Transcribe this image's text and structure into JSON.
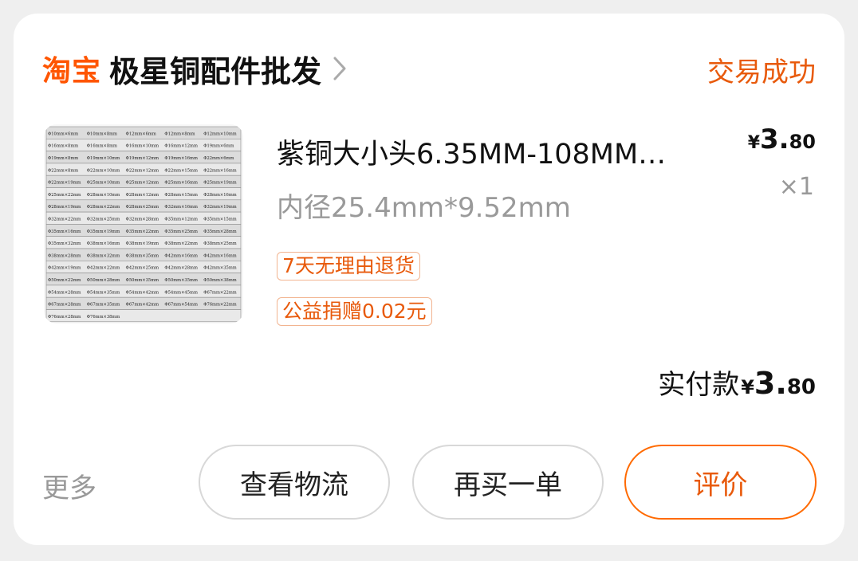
{
  "header": {
    "brand": "淘宝",
    "shop_name": "极星铜配件批发",
    "chevron_icon": "chevron-right-icon",
    "status": "交易成功"
  },
  "item": {
    "title": "紫铜大小头6.35MM-108MM…",
    "spec": "内径25.4mm*9.52mm",
    "price_symbol": "¥",
    "price_int": "3.",
    "price_dec": "80",
    "quantity": "×1",
    "thumbnail": {
      "description": "copper reducer size table",
      "cells": [
        [
          "Φ10mm×6mm",
          "Φ10mm×8mm",
          "Φ12mm×6mm",
          "Φ12mm×8mm",
          "Φ12mm×10mm"
        ],
        [
          "Φ16mm×8mm",
          "Φ16mm×8mm",
          "Φ16mm×10mm",
          "Φ16mm×12mm",
          "Φ19mm×6mm"
        ],
        [
          "Φ19mm×8mm",
          "Φ19mm×10mm",
          "Φ19mm×12mm",
          "Φ19mm×16mm",
          "Φ22mm×6mm"
        ],
        [
          "Φ22mm×8mm",
          "Φ22mm×10mm",
          "Φ22mm×12mm",
          "Φ22mm×15mm",
          "Φ22mm×16mm"
        ],
        [
          "Φ22mm×19mm",
          "Φ25mm×10mm",
          "Φ25mm×12mm",
          "Φ25mm×16mm",
          "Φ25mm×19mm"
        ],
        [
          "Φ25mm×22mm",
          "Φ28mm×10mm",
          "Φ28mm×12mm",
          "Φ28mm×15mm",
          "Φ28mm×16mm"
        ],
        [
          "Φ28mm×19mm",
          "Φ28mm×22mm",
          "Φ28mm×25mm",
          "Φ32mm×16mm",
          "Φ32mm×19mm"
        ],
        [
          "Φ32mm×22mm",
          "Φ32mm×25mm",
          "Φ32mm×28mm",
          "Φ35mm×12mm",
          "Φ35mm×15mm"
        ],
        [
          "Φ35mm×16mm",
          "Φ35mm×19mm",
          "Φ35mm×22mm",
          "Φ35mm×25mm",
          "Φ35mm×28mm"
        ],
        [
          "Φ35mm×32mm",
          "Φ38mm×16mm",
          "Φ38mm×19mm",
          "Φ38mm×22mm",
          "Φ38mm×25mm"
        ],
        [
          "Φ38mm×28mm",
          "Φ38mm×32mm",
          "Φ38mm×35mm",
          "Φ42mm×16mm",
          "Φ42mm×16mm"
        ],
        [
          "Φ42mm×19mm",
          "Φ42mm×22mm",
          "Φ42mm×25mm",
          "Φ42mm×28mm",
          "Φ42mm×35mm"
        ],
        [
          "Φ50mm×22mm",
          "Φ50mm×28mm",
          "Φ50mm×35mm",
          "Φ50mm×35mm",
          "Φ50mm×38mm"
        ],
        [
          "Φ54mm×28mm",
          "Φ54mm×35mm",
          "Φ54mm×42mm",
          "Φ54mm×45mm",
          "Φ67mm×22mm"
        ],
        [
          "Φ67mm×28mm",
          "Φ67mm×35mm",
          "Φ67mm×42mm",
          "Φ67mm×54mm",
          "Φ76mm×22mm"
        ],
        [
          "Φ76mm×28mm",
          "Φ76mm×38mm",
          "",
          "",
          ""
        ]
      ]
    }
  },
  "tags": [
    "7天无理由退货",
    "公益捐赠0.02元"
  ],
  "payment": {
    "label": "实付款",
    "symbol": "¥",
    "int": "3.",
    "dec": "80"
  },
  "actions": {
    "more": "更多",
    "logistics": "查看物流",
    "rebuy": "再买一单",
    "review": "评价"
  },
  "colors": {
    "brand": "#ff5500",
    "accent": "#e85a0c",
    "background": "#efefef",
    "card": "#ffffff"
  }
}
